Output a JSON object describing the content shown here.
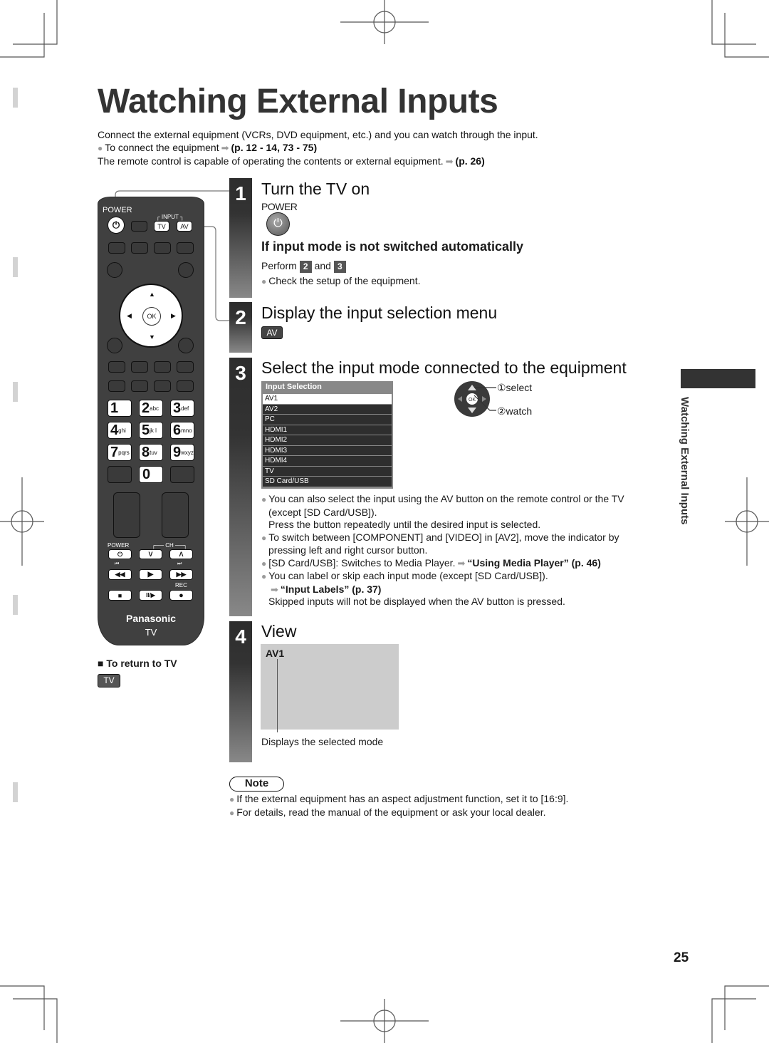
{
  "page": {
    "title": "Watching External Inputs",
    "page_number": "25",
    "side_tab_label": "Watching External Inputs"
  },
  "intro": {
    "line1": "Connect the external equipment (VCRs, DVD equipment, etc.) and you can watch through the input.",
    "line2_text": "To connect the equipment",
    "line2_ref": "(p. 12 - 14, 73 - 75)",
    "line3_text": "The remote control is capable of operating the contents or external equipment.",
    "line3_ref": "(p. 26)"
  },
  "remote": {
    "power_label": "POWER",
    "input_label": "INPUT",
    "tv_key": "TV",
    "av_key": "AV",
    "ok_label": "OK",
    "numbers": [
      {
        "digit": "1",
        "letters": ""
      },
      {
        "digit": "2",
        "letters": "abc"
      },
      {
        "digit": "3",
        "letters": "def"
      },
      {
        "digit": "4",
        "letters": "ghi"
      },
      {
        "digit": "5",
        "letters": "jk l"
      },
      {
        "digit": "6",
        "letters": "mno"
      },
      {
        "digit": "7",
        "letters": "pqrs"
      },
      {
        "digit": "8",
        "letters": "tuv"
      },
      {
        "digit": "9",
        "letters": "wxyz"
      }
    ],
    "zero": "0",
    "lower_power_label": "POWER",
    "ch_label": "CH",
    "rec_label": "REC",
    "brand": "Panasonic",
    "model": "TV"
  },
  "return_to_tv": {
    "label": "To return to TV",
    "key": "TV"
  },
  "steps": [
    {
      "number": "1",
      "title": "Turn the TV on",
      "key_label": "POWER"
    },
    {
      "number": "2",
      "title": "Display the input selection menu",
      "key_label": "AV"
    },
    {
      "number": "3",
      "title": "Select the input mode connected to the equipment"
    },
    {
      "number": "4",
      "title": "View"
    }
  ],
  "step1": {
    "subheading": "If input mode is not switched automatically",
    "perform_prefix": "Perform",
    "perform_a": "2",
    "perform_and": "and",
    "perform_b": "3",
    "bullet": "Check the setup of the equipment."
  },
  "input_menu": {
    "title": "Input Selection",
    "selected": "AV1",
    "items": [
      "AV1",
      "AV2",
      "PC",
      "HDMI1",
      "HDMI2",
      "HDMI3",
      "HDMI4",
      "TV",
      "SD Card/USB"
    ]
  },
  "nav_hint": {
    "ok": "OK",
    "select": "①select",
    "watch": "②watch"
  },
  "step3_notes": {
    "b1_line1": "You can also select the input using the AV button on the remote control or the TV",
    "b1_line2": "(except [SD Card/USB]).",
    "b1_line3": "Press the button repeatedly until the desired input is selected.",
    "b2_line1": "To switch between [COMPONENT] and [VIDEO] in [AV2], move the indicator by",
    "b2_line2": "pressing left and right cursor button.",
    "b3_text": "[SD Card/USB]: Switches to Media Player.",
    "b3_ref": "“Using Media Player” (p. 46)",
    "b4_line1": "You can label or skip each input mode (except [SD Card/USB]).",
    "b4_ref": "“Input Labels” (p. 37)",
    "b4_line3": "Skipped inputs will not be displayed when the AV button is pressed."
  },
  "step4": {
    "screen_label": "AV1",
    "caption": "Displays the selected mode"
  },
  "note": {
    "label": "Note",
    "items": [
      "If the external equipment has an aspect adjustment function, set it to [16:9].",
      "For details, read the manual of the equipment or ask your local dealer."
    ]
  }
}
